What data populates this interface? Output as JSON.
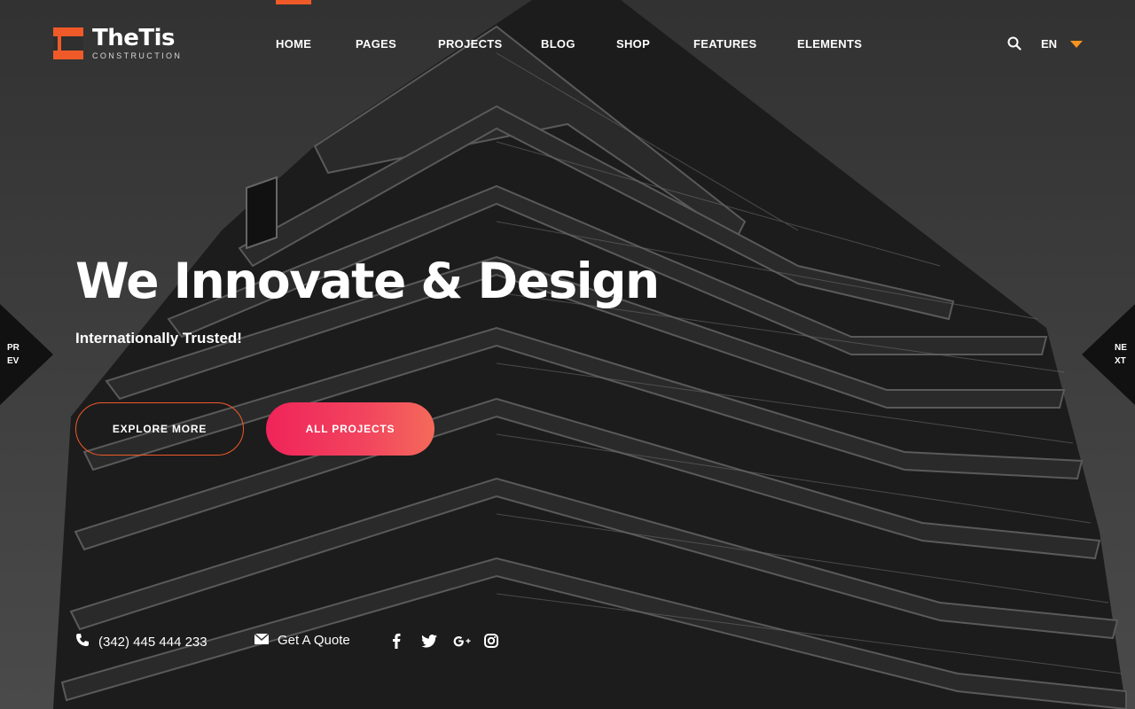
{
  "brand": {
    "name": "TheTis",
    "tagline": "CONSTRUCTION",
    "accent_color": "#f05a28"
  },
  "nav": {
    "items": [
      {
        "label": "HOME",
        "active": true
      },
      {
        "label": "PAGES"
      },
      {
        "label": "PROJECTS"
      },
      {
        "label": "BLOG"
      },
      {
        "label": "SHOP"
      },
      {
        "label": "FEATURES"
      },
      {
        "label": "ELEMENTS"
      }
    ],
    "search_icon": "search-icon",
    "language": "EN",
    "caret_color": "#f7931e"
  },
  "hero": {
    "headline": "We Innovate & Design",
    "subline": "Internationally Trusted!",
    "explore_label": "EXPLORE MORE",
    "projects_label": "ALL PROJECTS",
    "prev_label_1": "PR",
    "prev_label_2": "EV",
    "next_label_1": "NE",
    "next_label_2": "XT"
  },
  "contacts": {
    "phone": "(342) 445 444 233",
    "quote": "Get A Quote",
    "social": [
      "facebook-icon",
      "twitter-icon",
      "google-plus-icon",
      "instagram-icon"
    ]
  }
}
